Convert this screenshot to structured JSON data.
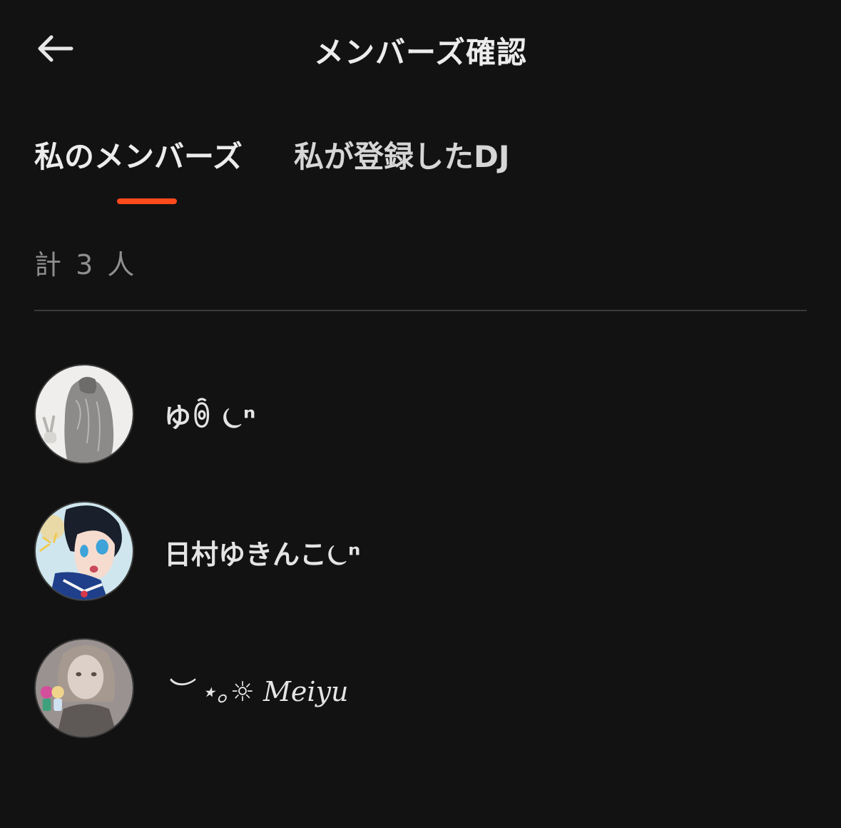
{
  "header": {
    "title": "メンバーズ確認",
    "back_icon": "arrow-left-icon"
  },
  "tabs": [
    {
      "label": "私のメンバーズ",
      "active": true
    },
    {
      "label": "私が登録したDJ",
      "active": false
    }
  ],
  "colors": {
    "accent": "#ff4a1c",
    "background": "#121212",
    "muted": "#8f8f8f"
  },
  "count_label": "計 3 人",
  "members": [
    {
      "name": "ゆꉺ ⏾ⁿ",
      "avatar": "girl-long-hair-sketch-avatar"
    },
    {
      "name": "日村ゆきんこ⏾ⁿ",
      "avatar": "anime-girl-sailor-uniform-avatar"
    },
    {
      "name": "︶ ⋆｡☼ 𝑀𝑒𝑖𝑦𝑢",
      "avatar": "photo-girl-with-chibi-stickers-avatar"
    }
  ]
}
